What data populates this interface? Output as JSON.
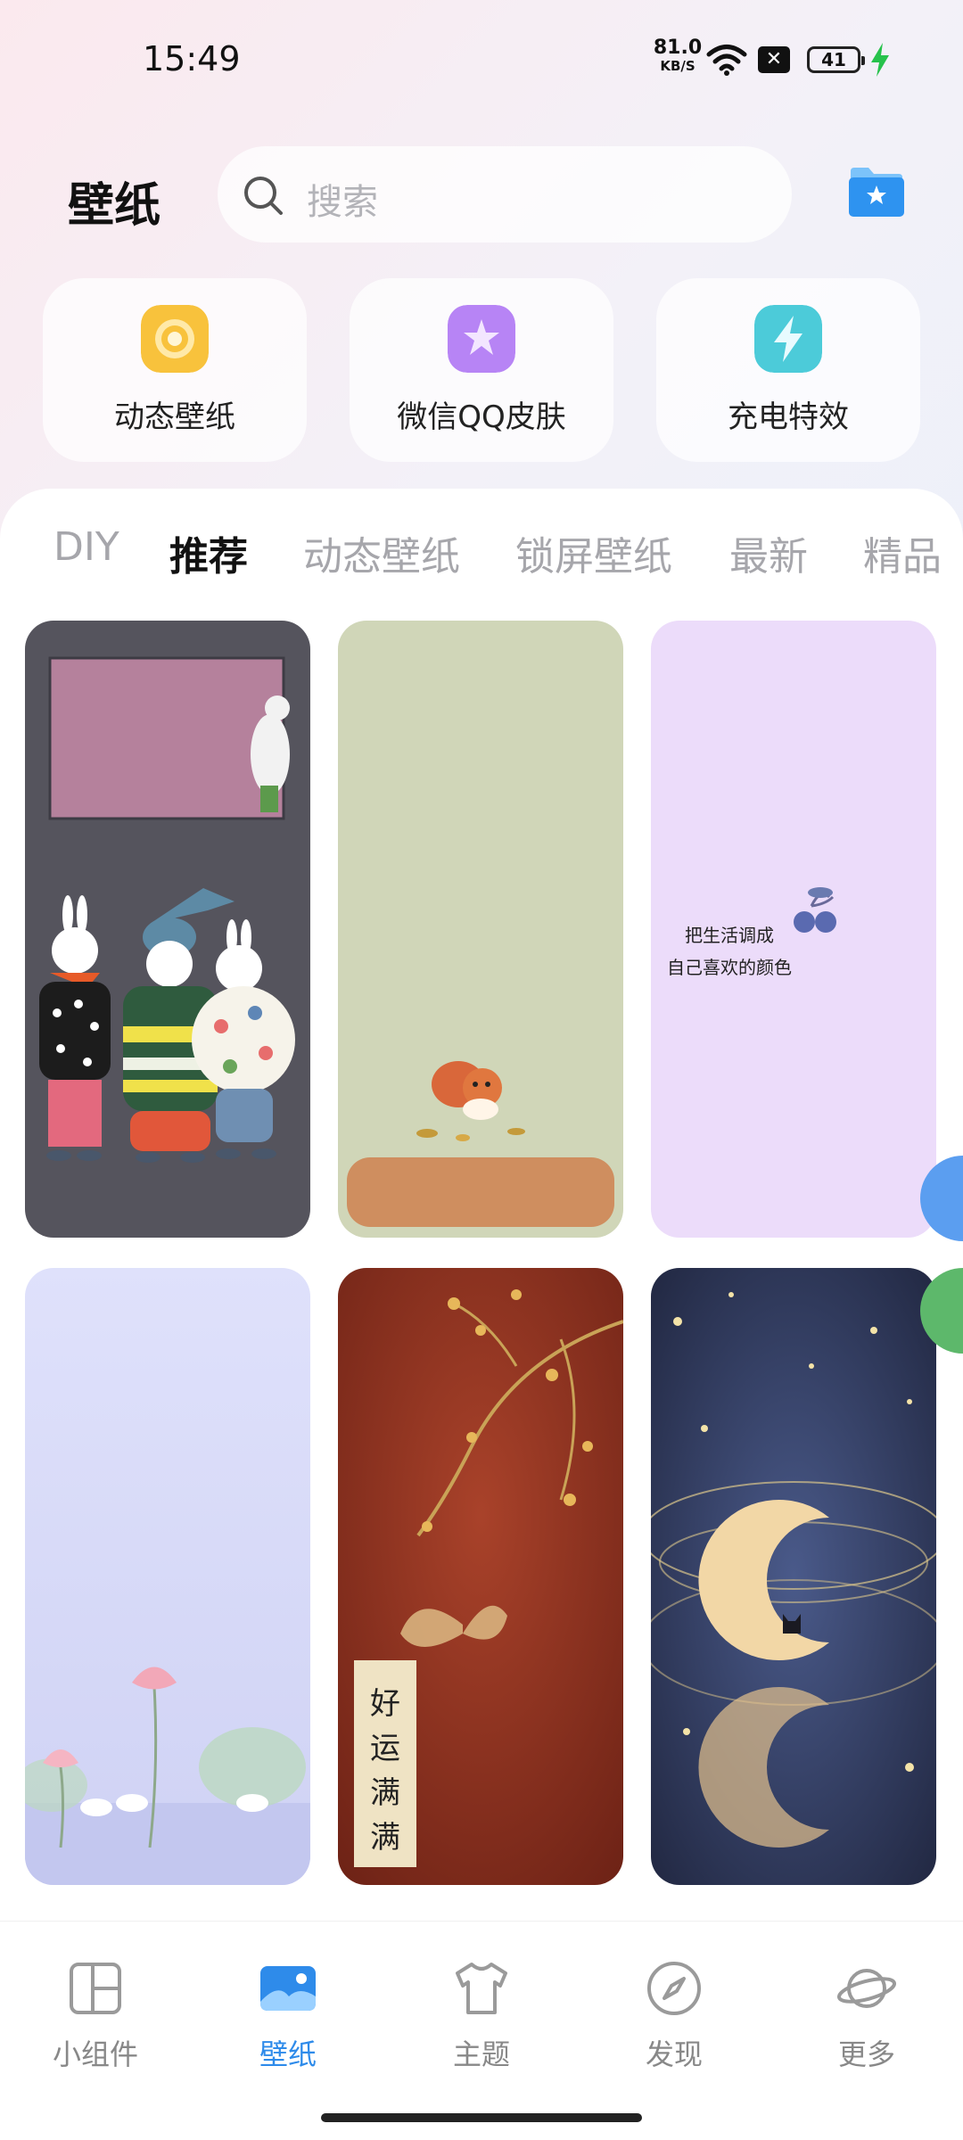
{
  "status": {
    "time": "15:49",
    "net_speed": "81.0",
    "net_unit": "KB/S",
    "battery": "41"
  },
  "header": {
    "title": "壁纸",
    "search_placeholder": "搜索"
  },
  "quick": [
    {
      "label": "动态壁纸",
      "icon": "live-wallpaper-icon",
      "color": "#f7c03a"
    },
    {
      "label": "微信QQ皮肤",
      "icon": "skin-star-icon",
      "color": "#b07cf2"
    },
    {
      "label": "充电特效",
      "icon": "charging-bolt-icon",
      "color": "#48c9d8"
    }
  ],
  "tabs": [
    "DIY",
    "推荐",
    "动态壁纸",
    "锁屏壁纸",
    "最新",
    "精品"
  ],
  "active_tab": "推荐",
  "wallpapers": [
    {
      "name": "bunnies-scarves",
      "text": ""
    },
    {
      "name": "squirrel-green",
      "text": ""
    },
    {
      "name": "lavender-cherries",
      "text": "把生活调成\n自己喜欢的颜色"
    },
    {
      "name": "lotus-geese",
      "text": ""
    },
    {
      "name": "red-butterfly",
      "text": "好运满满"
    },
    {
      "name": "moon-cat",
      "text": ""
    }
  ],
  "nav": [
    {
      "label": "小组件",
      "icon": "widget-icon"
    },
    {
      "label": "壁纸",
      "icon": "wallpaper-icon"
    },
    {
      "label": "主题",
      "icon": "theme-shirt-icon"
    },
    {
      "label": "发现",
      "icon": "discover-compass-icon"
    },
    {
      "label": "更多",
      "icon": "more-planet-icon"
    }
  ],
  "active_nav": "壁纸",
  "colors": {
    "accent": "#2e8bea"
  }
}
